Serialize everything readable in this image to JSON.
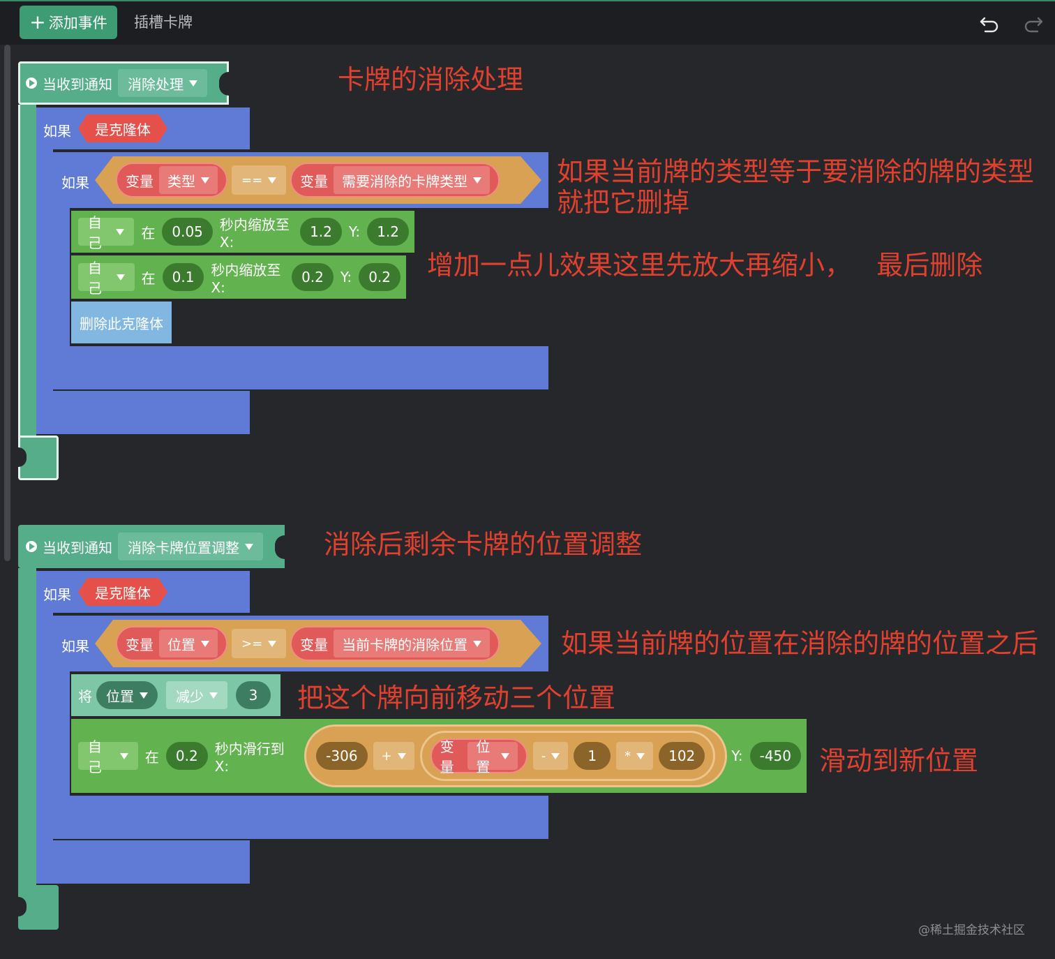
{
  "toolbar": {
    "add_event": "添加事件",
    "tab": "插槽卡牌"
  },
  "event1": {
    "hat_label": "当收到通知",
    "hat_value": "消除处理",
    "if_outer": "如果",
    "clone_cond": "是克隆体",
    "if_inner": "如果",
    "cond_left_kind": "变量",
    "cond_left_value": "类型",
    "cond_op": "==",
    "cond_right_kind": "变量",
    "cond_right_value": "需要消除的卡牌类型",
    "scale1": {
      "target": "自己",
      "in": "在",
      "time": "0.05",
      "text": "秒内缩放至X:",
      "x": "1.2",
      "ylabel": "Y:",
      "y": "1.2"
    },
    "scale2": {
      "target": "自己",
      "in": "在",
      "time": "0.1",
      "text": "秒内缩放至X:",
      "x": "0.2",
      "ylabel": "Y:",
      "y": "0.2"
    },
    "delete_clone": "删除此克隆体"
  },
  "event2": {
    "hat_label": "当收到通知",
    "hat_value": "消除卡牌位置调整",
    "if_outer": "如果",
    "clone_cond": "是克隆体",
    "if_inner": "如果",
    "cond_left_kind": "变量",
    "cond_left_value": "位置",
    "cond_op": ">=",
    "cond_right_kind": "变量",
    "cond_right_value": "当前卡牌的消除位置",
    "change": {
      "verb": "将",
      "var": "位置",
      "op": "减少",
      "amount": "3"
    },
    "glide": {
      "target": "自己",
      "in": "在",
      "time": "0.2",
      "text": "秒内滑行到 X:",
      "x_base": "-306",
      "op_plus": "+",
      "var_kind": "变量",
      "var_value": "位置",
      "op_minus": "-",
      "minus_value": "1",
      "op_times": "*",
      "times_value": "102",
      "ylabel": "Y:",
      "y": "-450"
    }
  },
  "annotations": {
    "a1": "卡牌的消除处理",
    "a2_line1": "如果当前牌的类型等于要消除的牌的类型",
    "a2_line2": "就把它删掉",
    "a3": "增加一点儿效果这里先放大再缩小，   最后删除",
    "a4": "消除后剩余卡牌的位置调整",
    "a5": "如果当前牌的位置在消除的牌的位置之后",
    "a6": "把这个牌向前移动三个位置",
    "a7": "滑动到新位置"
  },
  "watermark": "@稀土掘金技术社区",
  "colors": {
    "background": "#26272b",
    "event": "#55ad8a",
    "control": "#5f7bd6",
    "condition": "#d8a154",
    "variable": "#df5a59",
    "motion": "#62b24f",
    "clone": "#e5504b",
    "data": "#7dc7a6",
    "annotation": "#e0412f"
  },
  "icons": [
    "plus-icon",
    "undo-icon",
    "redo-icon",
    "play-icon",
    "dropdown-arrow-icon"
  ]
}
